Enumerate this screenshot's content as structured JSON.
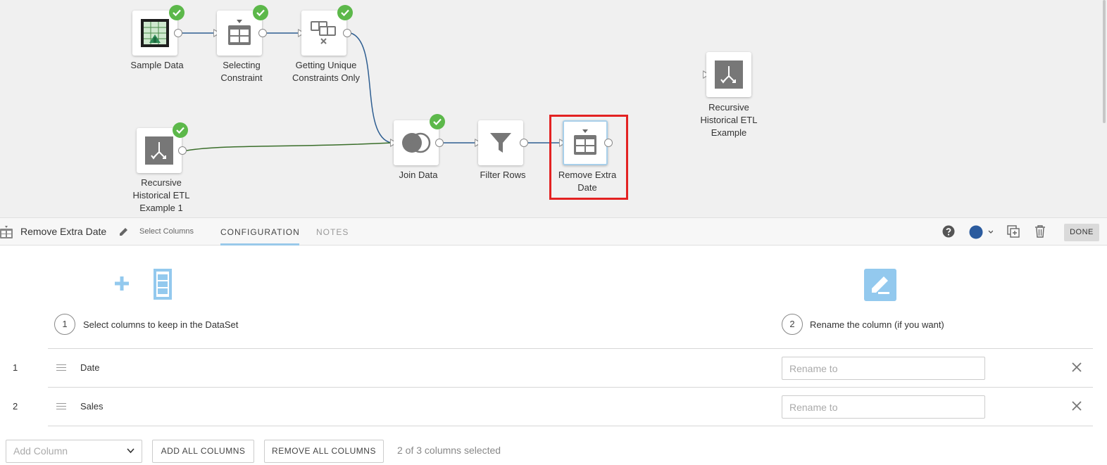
{
  "canvas": {
    "nodes": {
      "sample_data": {
        "label": "Sample Data"
      },
      "selecting_constraint": {
        "label": "Selecting\nConstraint"
      },
      "unique_constraints": {
        "label": "Getting Unique\nConstraints Only"
      },
      "recursive_1": {
        "label": "Recursive\nHistorical ETL\nExample 1"
      },
      "join_data": {
        "label": "Join Data"
      },
      "filter_rows": {
        "label": "Filter Rows"
      },
      "remove_extra_date": {
        "label": "Remove Extra\nDate"
      },
      "recursive_example": {
        "label": "Recursive\nHistorical ETL\nExample"
      }
    }
  },
  "toolbar": {
    "title": "Remove Extra Date",
    "subtitle": "Select Columns",
    "tabs": {
      "configuration": "CONFIGURATION",
      "notes": "NOTES"
    },
    "done_label": "DONE",
    "accent_color": "#2b5b9e"
  },
  "panel": {
    "steps": [
      {
        "number": "1",
        "text": "Select columns to keep in the DataSet"
      },
      {
        "number": "2",
        "text": "Rename the column (if you want)"
      }
    ],
    "rows": [
      {
        "index": "1",
        "column": "Date",
        "rename_placeholder": "Rename to"
      },
      {
        "index": "2",
        "column": "Sales",
        "rename_placeholder": "Rename to"
      }
    ],
    "add_column_placeholder": "Add Column",
    "add_all_label": "ADD ALL COLUMNS",
    "remove_all_label": "REMOVE ALL COLUMNS",
    "selected_count": "2 of 3 columns selected"
  },
  "colors": {
    "success": "#5cb84a",
    "wire_blue": "#2e5e91",
    "wire_green": "#3a6e2a",
    "highlight": "#e32222",
    "icon_light_blue": "#93c9ee"
  }
}
